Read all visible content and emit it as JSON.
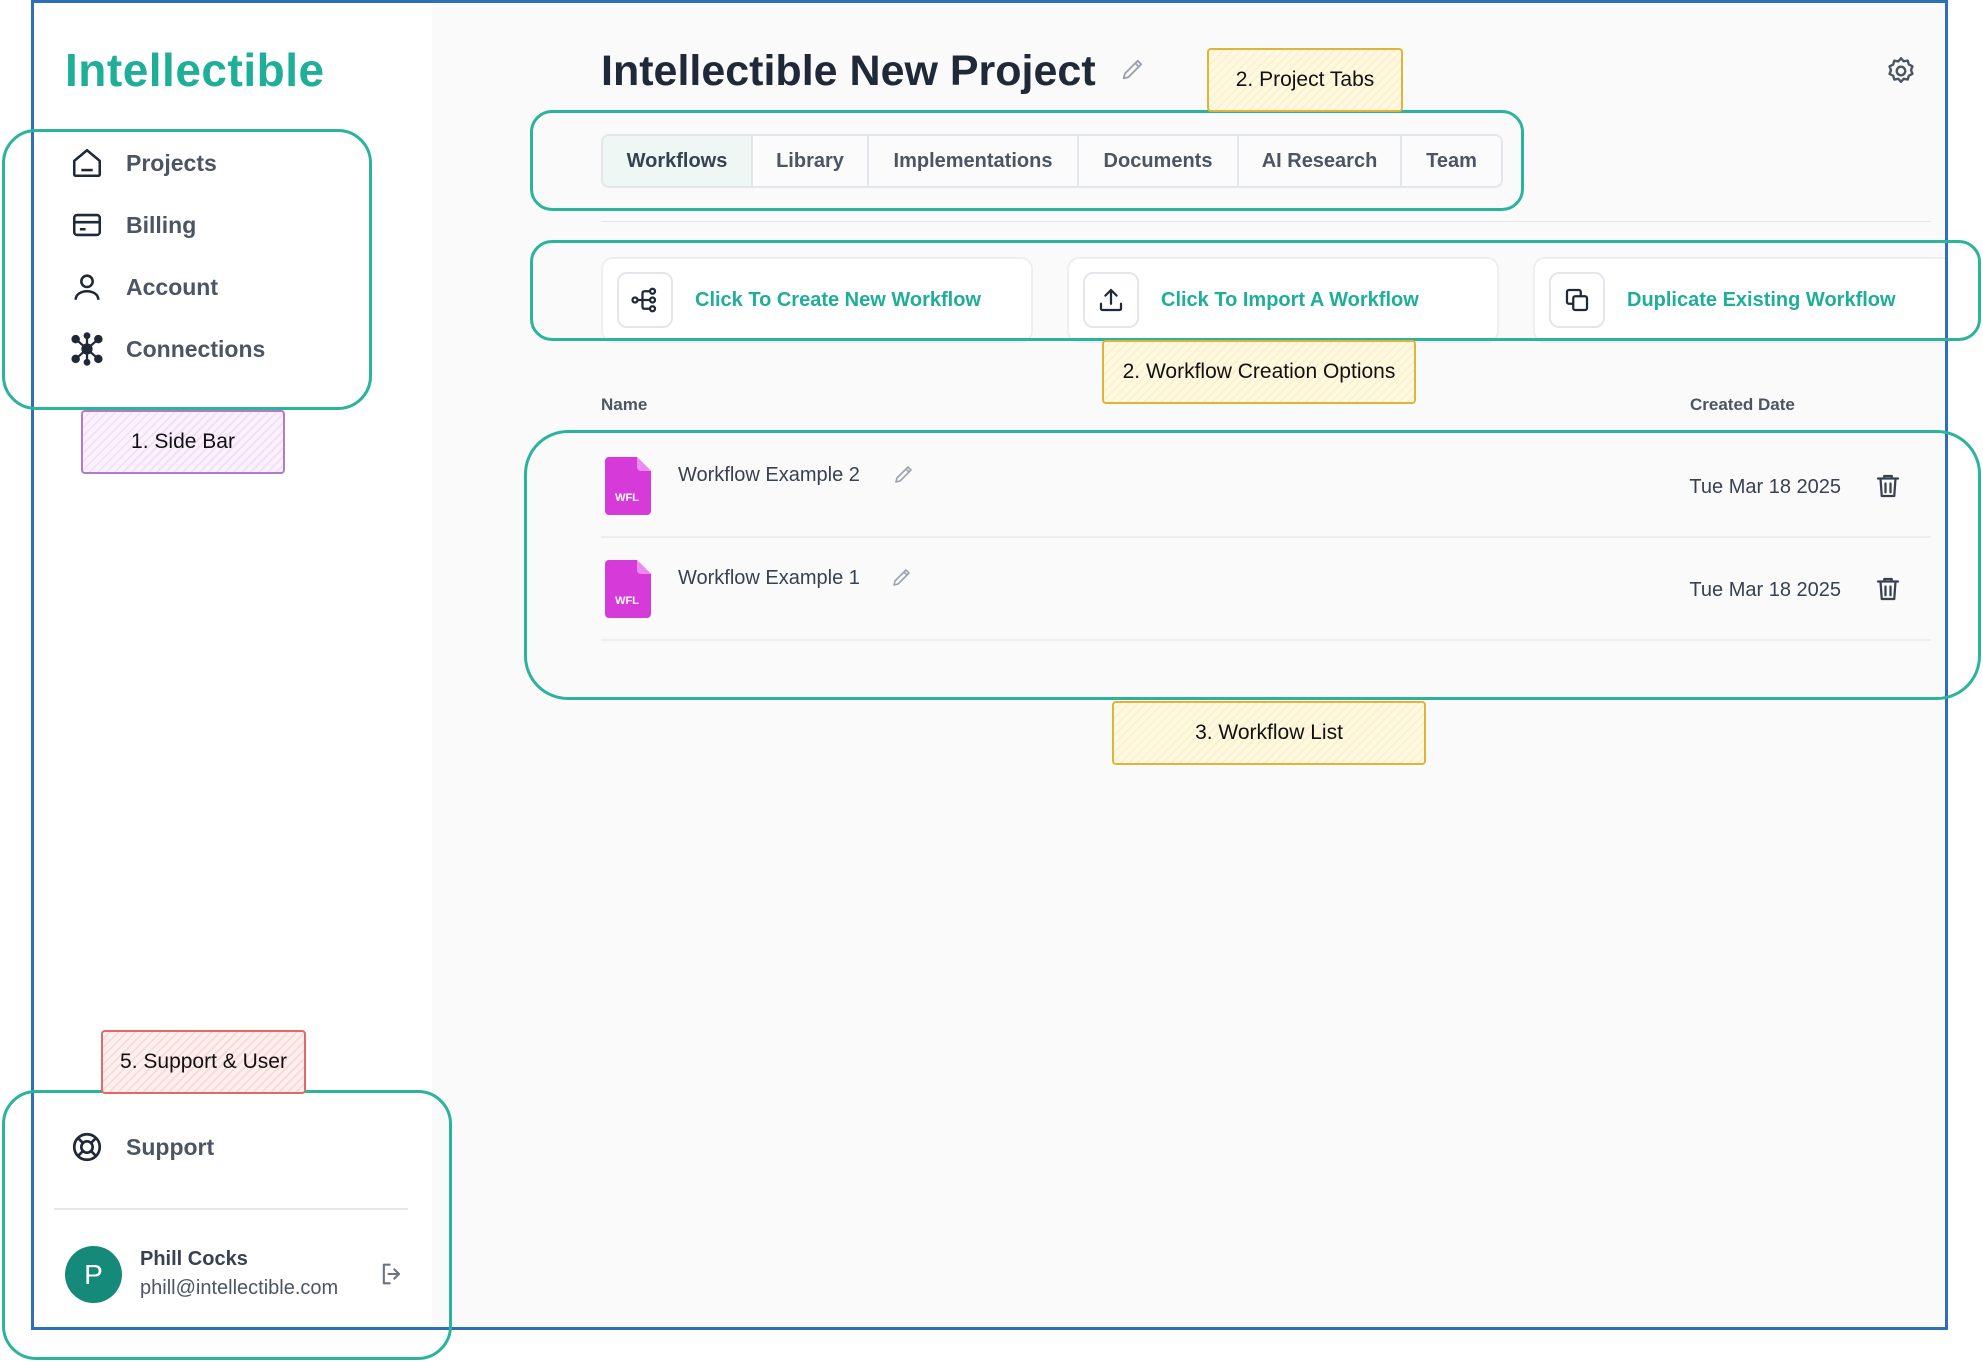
{
  "app": {
    "logo": "Intellectible"
  },
  "sidebar": {
    "items": [
      {
        "label": "Projects",
        "icon": "home-icon"
      },
      {
        "label": "Billing",
        "icon": "credit-card-icon"
      },
      {
        "label": "Account",
        "icon": "user-icon"
      },
      {
        "label": "Connections",
        "icon": "network-icon"
      }
    ],
    "support": {
      "label": "Support",
      "icon": "lifebuoy-icon"
    },
    "user": {
      "initial": "P",
      "name": "Phill Cocks",
      "email": "phill@intellectible.com"
    }
  },
  "header": {
    "title": "Intellectible New Project"
  },
  "tabs": [
    {
      "label": "Workflows",
      "active": true
    },
    {
      "label": "Library"
    },
    {
      "label": "Implementations"
    },
    {
      "label": "Documents"
    },
    {
      "label": "AI Research"
    },
    {
      "label": "Team"
    }
  ],
  "actions": [
    {
      "label": "Click To Create New Workflow",
      "icon": "workflow-icon"
    },
    {
      "label": "Click To Import A Workflow",
      "icon": "upload-icon"
    },
    {
      "label": "Duplicate Existing Workflow",
      "icon": "copy-icon"
    }
  ],
  "table": {
    "columns": {
      "name": "Name",
      "created": "Created Date"
    },
    "rows": [
      {
        "name": "Workflow Example 2",
        "date": "Tue Mar 18 2025",
        "file_badge": "WFL"
      },
      {
        "name": "Workflow Example 1",
        "date": "Tue Mar 18 2025",
        "file_badge": "WFL"
      }
    ]
  },
  "annotations": {
    "sidebar": "1. Side Bar",
    "tabs": "2. Project Tabs",
    "creation": "2. Workflow Creation Options",
    "list": "3. Workflow List",
    "support_user": "5. Support & User"
  },
  "colors": {
    "brand": "#1fae98",
    "highlight": "#2bb39c",
    "frame": "#2f6fb3",
    "file_icon": "#d63ad8",
    "avatar": "#158a7a"
  }
}
